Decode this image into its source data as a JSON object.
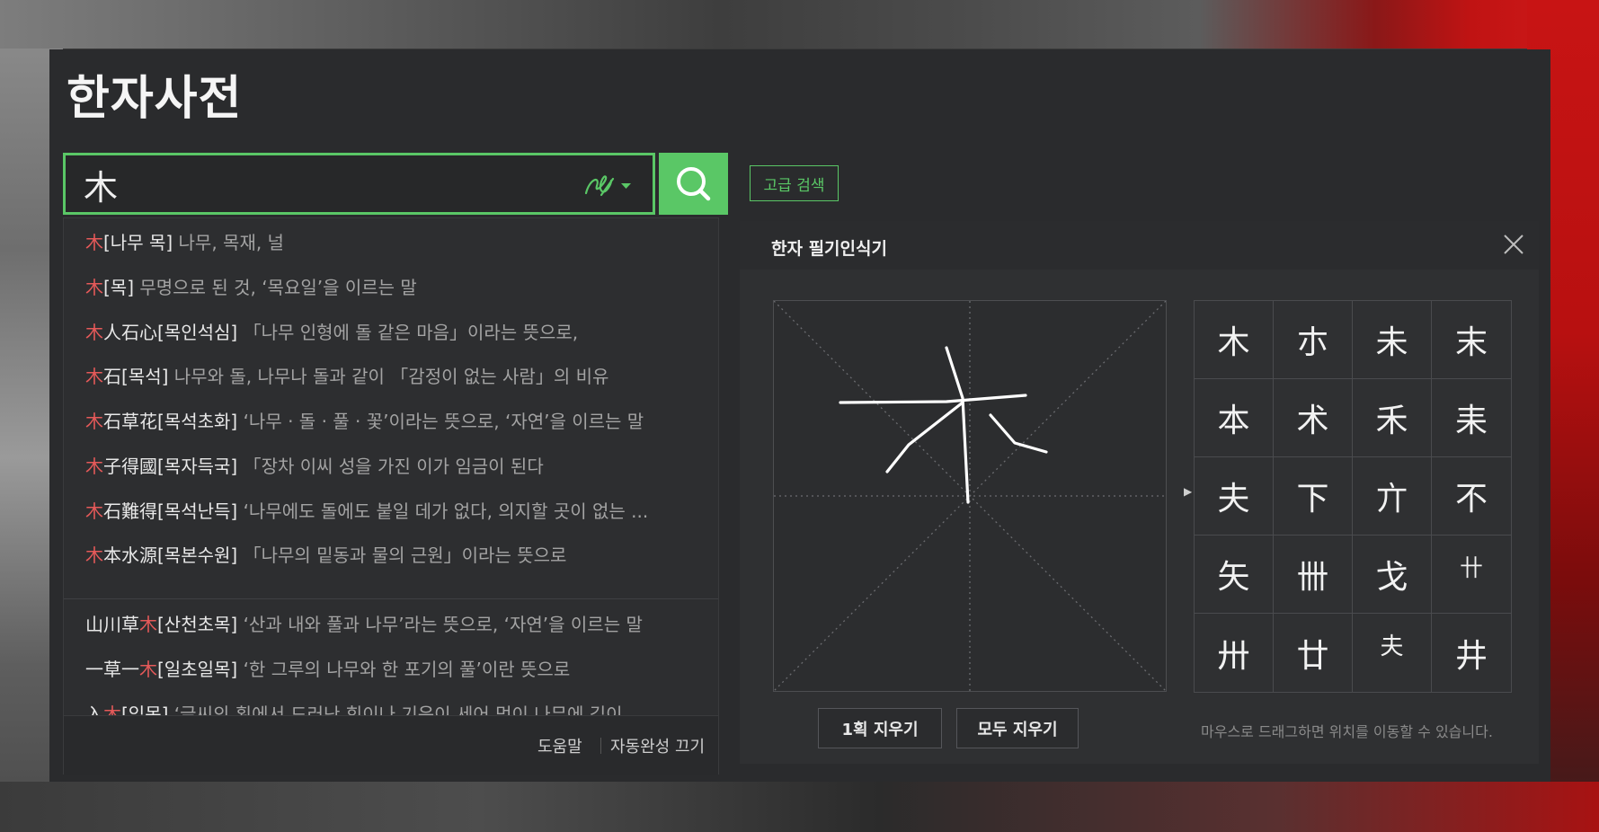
{
  "app": {
    "title": "한자사전"
  },
  "search": {
    "value": "木",
    "button_label": "검색",
    "advanced_label": "고급 검색"
  },
  "autocomplete": {
    "items": [
      {
        "hl": "木",
        "word": "",
        "bracket": "[나무 목]",
        "meaning": "나무, 목재, 널"
      },
      {
        "hl": "木",
        "word": "",
        "bracket": "[목]",
        "meaning": "무명으로 된 것, ‘목요일’을 이르는 말"
      },
      {
        "hl": "木",
        "word": "人石心",
        "bracket": "[목인석심]",
        "meaning": "「나무 인형에 돌 같은 마음」이라는 뜻으로,"
      },
      {
        "hl": "木",
        "word": "石",
        "bracket": "[목석]",
        "meaning": "나무와 돌, 나무나 돌과 같이 「감정이 없는 사람」의 비유"
      },
      {
        "hl": "木",
        "word": "石草花",
        "bracket": "[목석초화]",
        "meaning": "‘나무 · 돌 · 풀 · 꽃’이라는 뜻으로, ‘자연’을 이르는 말"
      },
      {
        "hl": "木",
        "word": "子得國",
        "bracket": "[목자득국]",
        "meaning": "「장차 이씨 성을 가진 이가 임금이 된다"
      },
      {
        "hl": "木",
        "word": "石難得",
        "bracket": "[목석난득]",
        "meaning": "‘나무에도 돌에도 붙일 데가 없다, 의지할 곳이 없는 ..."
      },
      {
        "hl": "木",
        "word": "本水源",
        "bracket": "[목본수원]",
        "meaning": "「나무의 밑동과 물의 근원」이라는 뜻으로"
      }
    ],
    "contains": [
      {
        "pre": "山川草",
        "hl": "木",
        "post": "",
        "bracket": "[산천초목]",
        "meaning": "‘산과 내와 풀과 나무’라는 뜻으로, ‘자연’을 이르는 말"
      },
      {
        "pre": "一草一",
        "hl": "木",
        "post": "",
        "bracket": "[일초일목]",
        "meaning": "‘한 그루의 나무와 한 포기의 풀’이란 뜻으로"
      },
      {
        "pre": "入",
        "hl": "木",
        "post": "",
        "bracket": "[입목]",
        "meaning": "‘글씨의 획에서 드러난 힘이나 기운이 세어 먹이 나무에 깊이 ..."
      }
    ],
    "footer": {
      "help": "도움말",
      "autocomplete_off": "자동완성 끄기"
    }
  },
  "handwriting": {
    "title": "한자 필기인식기",
    "candidates": [
      "木",
      "朩",
      "未",
      "末",
      "本",
      "术",
      "禾",
      "耒",
      "夫",
      "下",
      "亣",
      "不",
      "矢",
      "卌",
      "戈",
      "卄",
      "卅",
      "廿",
      "夫",
      "井"
    ],
    "undo_stroke_label": "1획 지우기",
    "clear_all_label": "모두 지우기",
    "hint": "마우스로 드래그하면 위치를 이동할 수 있습니다."
  },
  "colors": {
    "accent": "#5ac766",
    "highlight": "#e55959",
    "panel": "#2a2b2d"
  }
}
